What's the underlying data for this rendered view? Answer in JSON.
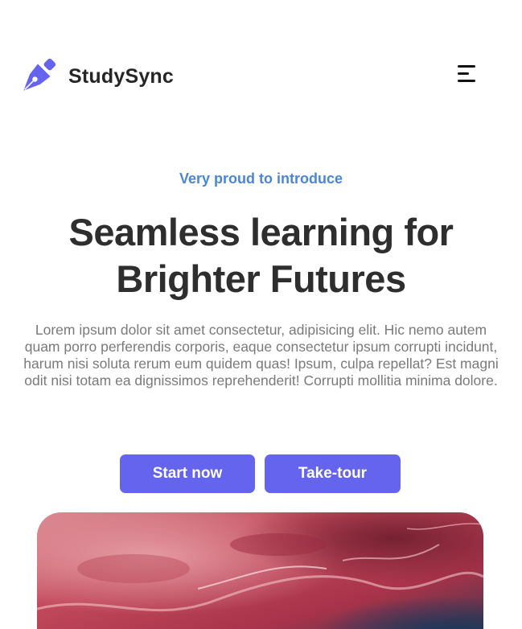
{
  "header": {
    "brand": "StudySync",
    "logo_icon": "fountain-pen-icon",
    "menu_icon": "hamburger-menu-icon"
  },
  "hero": {
    "eyebrow": "Very proud to introduce",
    "headline_line1": "Seamless learning for",
    "headline_line2": "Brighter Futures",
    "description": "Lorem ipsum dolor sit amet consectetur, adipisicing elit. Hic nemo autem quam porro perferendis corporis, eaque consectetur ipsum corrupti incidunt, harum nisi soluta rerum eum quidem quas! Ipsum, culpa repellat? Est magni odit nisi totam ea dignissimos reprehenderit! Corrupti mollitia minima dolore."
  },
  "actions": {
    "start_label": "Start now",
    "tour_label": "Take-tour"
  },
  "colors": {
    "accent": "#6464ee",
    "eyebrow": "#4a86d6",
    "heading": "#2e2e2e",
    "body_text": "#7a7a7a"
  }
}
